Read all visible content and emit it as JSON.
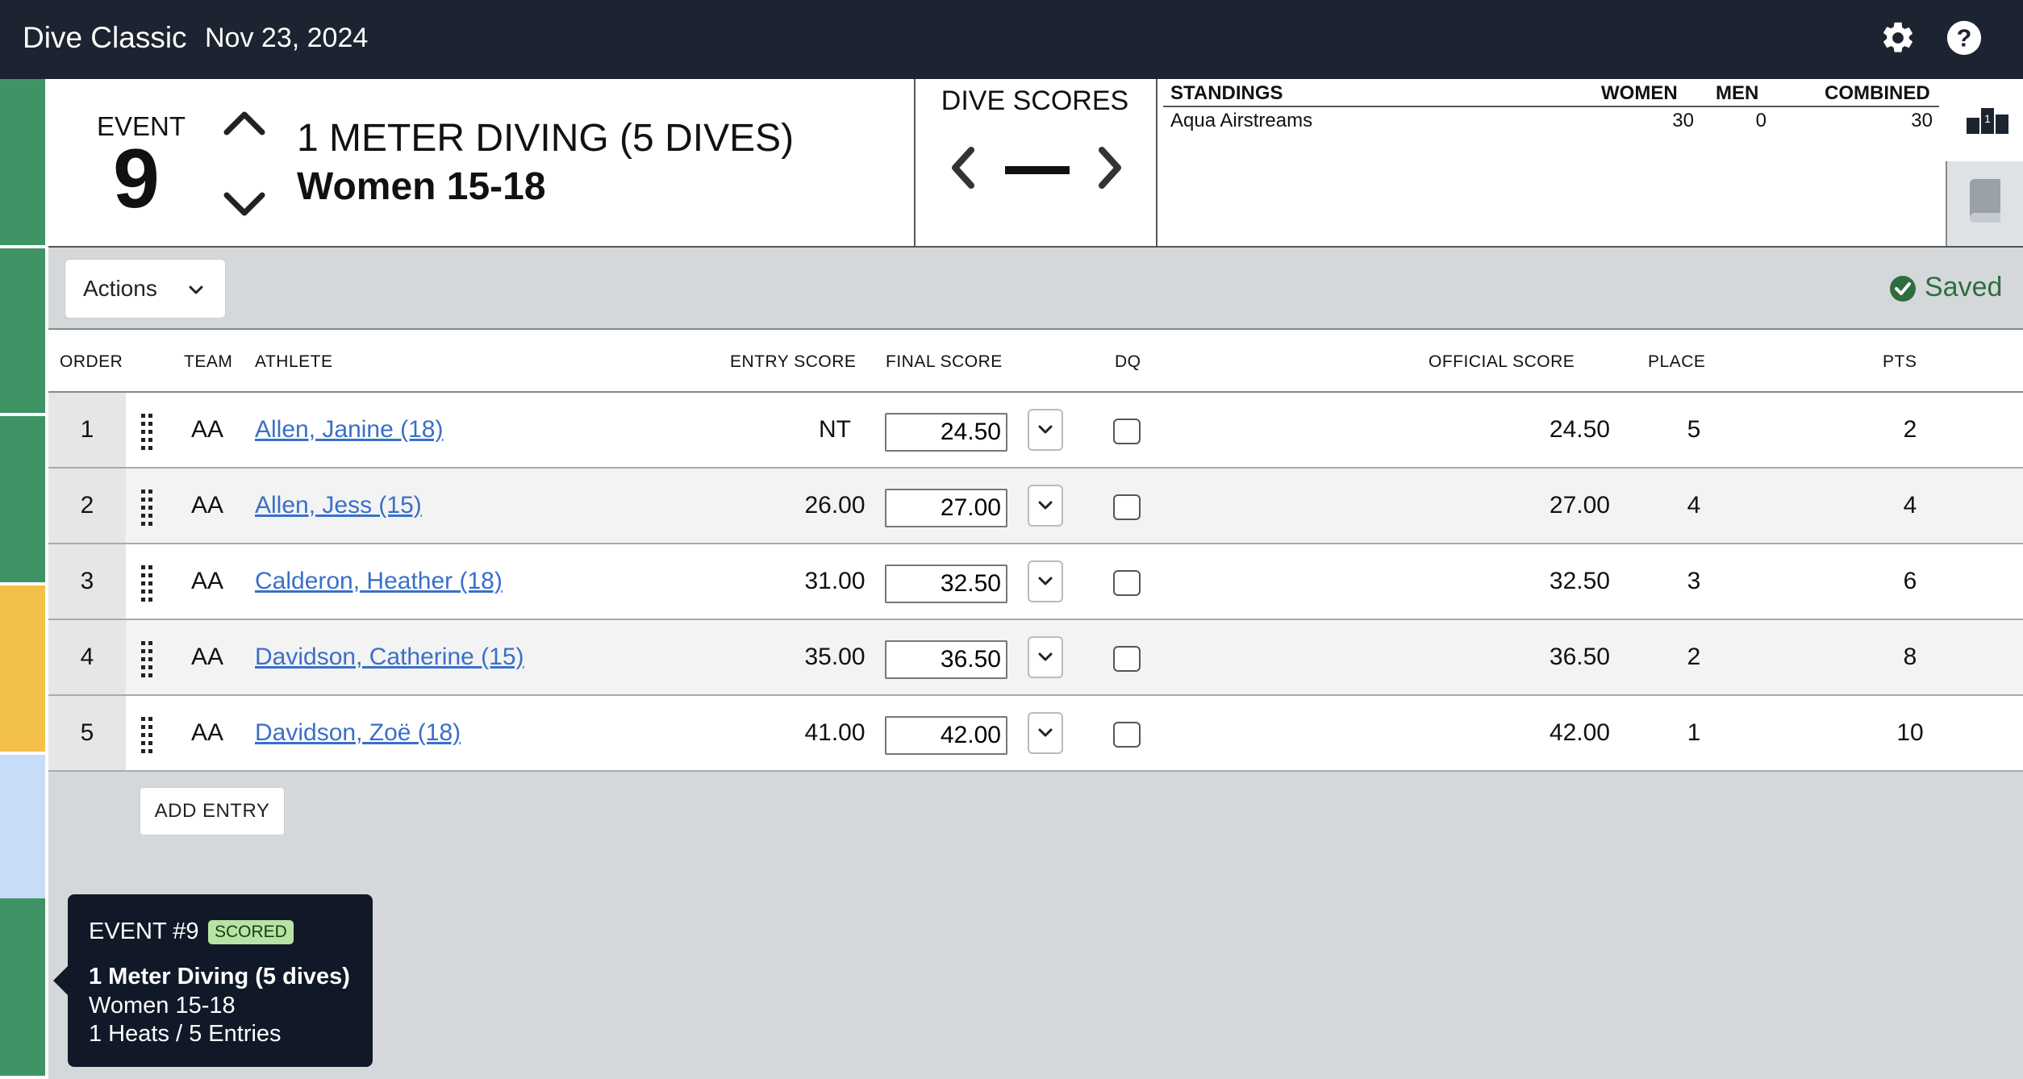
{
  "app": {
    "title": "Dive Classic",
    "date": "Nov 23, 2024"
  },
  "topbar": {
    "settings_icon": "gear-icon",
    "help_icon": "help-icon"
  },
  "event": {
    "label": "EVENT",
    "number": "9",
    "name": "1 METER DIVING (5 DIVES)",
    "group": "Women 15-18"
  },
  "dive_scores": {
    "title": "DIVE SCORES",
    "value": "—"
  },
  "standings": {
    "headers": {
      "title": "STANDINGS",
      "women": "WOMEN",
      "men": "MEN",
      "combined": "COMBINED"
    },
    "rows": [
      {
        "team": "Aqua Airstreams",
        "women": "30",
        "men": "0",
        "combined": "30"
      }
    ]
  },
  "actions": {
    "label": "Actions"
  },
  "status": {
    "saved": "Saved",
    "color": "#2f6d3e"
  },
  "table": {
    "headers": {
      "order": "ORDER",
      "team": "TEAM",
      "athlete": "ATHLETE",
      "entry_score": "ENTRY SCORE",
      "final_score": "FINAL SCORE",
      "dq": "DQ",
      "official_score": "OFFICIAL SCORE",
      "place": "PLACE",
      "pts": "PTS"
    },
    "rows": [
      {
        "order": "1",
        "team": "AA",
        "athlete": "Allen, Janine (18)",
        "entry_score": "NT",
        "final_score": "24.50",
        "official_score": "24.50",
        "place": "5",
        "pts": "2"
      },
      {
        "order": "2",
        "team": "AA",
        "athlete": "Allen, Jess (15)",
        "entry_score": "26.00",
        "final_score": "27.00",
        "official_score": "27.00",
        "place": "4",
        "pts": "4"
      },
      {
        "order": "3",
        "team": "AA",
        "athlete": "Calderon, Heather (18)",
        "entry_score": "31.00",
        "final_score": "32.50",
        "official_score": "32.50",
        "place": "3",
        "pts": "6"
      },
      {
        "order": "4",
        "team": "AA",
        "athlete": "Davidson, Catherine (15)",
        "entry_score": "35.00",
        "final_score": "36.50",
        "official_score": "36.50",
        "place": "2",
        "pts": "8"
      },
      {
        "order": "5",
        "team": "AA",
        "athlete": "Davidson, Zoë (18)",
        "entry_score": "41.00",
        "final_score": "42.00",
        "official_score": "42.00",
        "place": "1",
        "pts": "10"
      }
    ]
  },
  "add_entry": {
    "label": "ADD ENTRY"
  },
  "tooltip": {
    "event": "EVENT #9",
    "badge": "SCORED",
    "name": "1 Meter Diving (5 dives)",
    "group": "Women 15-18",
    "info": "1 Heats / 5 Entries"
  },
  "strip_colors": {
    "green": "#3f9465",
    "yellow": "#f2c04b",
    "blue": "#c7dcf8"
  }
}
